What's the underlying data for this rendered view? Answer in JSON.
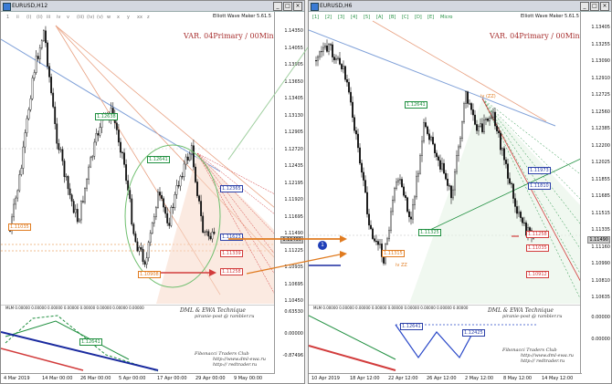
{
  "colors": {
    "bull": "#1a7a1a",
    "bear": "#1a1a1a",
    "accent": "#a83030",
    "fib_green": "#1f8f3f",
    "fib_red": "#d23c3c",
    "orange": "#e07b20",
    "blue_trend": "#2a3fa8"
  },
  "left": {
    "title": "EURUSD,H12",
    "ewm": "Elliott Wave Maker 5.61.5",
    "var": "VAR. 04Primary / 00Minute",
    "dml_line1": "DML & EWA Technique",
    "dml_line2": "piranie-post @ rambler.ru",
    "fib_line1": "Fibonacci Traders Club",
    "fib_line2": "http://www.dml-ewa.ru",
    "fib_line3": "http:// redtrader.ru",
    "mlm": "MLM 0.00000 0.00000 0.00000 0.00000 0.00000 0.00000 0.00000 0.00000",
    "price_ticks": [
      "1.14350",
      "1.14055",
      "1.13905",
      "1.13650",
      "1.13405",
      "1.13130",
      "1.12905",
      "1.12720",
      "1.12435",
      "1.12195",
      "1.11920",
      "1.11695",
      "1.11490",
      "1.11225",
      "1.10935",
      "1.10695",
      "1.10450"
    ],
    "sub_ticks": [
      "0.63530",
      "0.00000",
      "-0.87496"
    ],
    "time_ticks": [
      "4 Mar 2019",
      "14 Mar 00:00",
      "26 Mar 00:00",
      "5 Apr 00:00",
      "17 Apr 00:00",
      "29 Apr 00:00",
      "9 May 00:00"
    ],
    "waves": [
      "1",
      "ii",
      "(i)",
      "(ii)",
      "iii",
      "iv",
      "v",
      "(iii)",
      "(iv)",
      "(v)",
      "w",
      "x",
      "y",
      "xx",
      "z"
    ],
    "boxes": [
      {
        "text": "1.12638",
        "color": "#1f8f3f"
      },
      {
        "text": "1.12641",
        "color": "#1f8f3f"
      },
      {
        "text": "1.12365",
        "color": "#2a3fa8"
      },
      {
        "text": "1.11623",
        "color": "#2a3fa8"
      },
      {
        "text": "1.11339",
        "color": "#d23c3c"
      },
      {
        "text": "1.11258",
        "color": "#d23c3c"
      },
      {
        "text": "1.11035",
        "color": "#e07b20"
      },
      {
        "text": "1.10908",
        "color": "#e07b20"
      },
      {
        "text": "1.12641",
        "color": "#1f8f3f"
      }
    ],
    "cursor_price": "1.11490"
  },
  "right": {
    "title": "EURUSD,H6",
    "ewm": "Elliott Wave Maker 5.61.5",
    "var": "VAR. 04Primary / 00Minute",
    "dml_line1": "DML & EWA Technique",
    "dml_line2": "piranie-post @ rambler.ru",
    "fib_line1": "Fibonacci Traders Club",
    "fib_line2": "http://www.dml-ewa.ru",
    "fib_line3": "http:// redtrader.ru",
    "mlm": "MLM 0.00000 0.00000 0.00000 0.00000 0.00000 0.00000 0.00000 0.00000 0.00000",
    "marker_number": "1",
    "price_ticks": [
      "1.13405",
      "1.13255",
      "1.13090",
      "1.12910",
      "1.12725",
      "1.12560",
      "1.12385",
      "1.12200",
      "1.12025",
      "1.11855",
      "1.11685",
      "1.11515",
      "1.11335",
      "1.11160",
      "1.10990",
      "1.10810",
      "1.10635"
    ],
    "sub_ticks": [
      "0.00000",
      "0.00000"
    ],
    "time_ticks": [
      "10 Apr 2019",
      "18 Apr 12:00",
      "22 Apr 12:00",
      "26 Apr 12:00",
      "2 May 12:00",
      "8 May 12:00",
      "14 May 12:00"
    ],
    "waves": [
      "[1]",
      "[2]",
      "[3]",
      "[4]",
      "[5]",
      "[A]",
      "[B]",
      "[C]",
      "[D]",
      "[E]",
      "Micro"
    ],
    "boxes": [
      {
        "text": "1.12641",
        "color": "#1f8f3f"
      },
      {
        "text": "1.11973",
        "color": "#2a3fa8"
      },
      {
        "text": "1.11810",
        "color": "#2a3fa8"
      },
      {
        "text": "1.11258",
        "color": "#d23c3c"
      },
      {
        "text": "1.11035",
        "color": "#d23c3c"
      },
      {
        "text": "1.10912",
        "color": "#d23c3c"
      },
      {
        "text": "1.11325",
        "color": "#1f8f3f"
      },
      {
        "text": "1.11315",
        "color": "#e07b20"
      },
      {
        "text": "1.12641",
        "color": "#2a3fa8"
      },
      {
        "text": "1.12425",
        "color": "#2a3fa8"
      }
    ],
    "label_iv": "iv (ZZ)",
    "label_v": "iv ZZ",
    "cursor_price": "1.11490"
  }
}
